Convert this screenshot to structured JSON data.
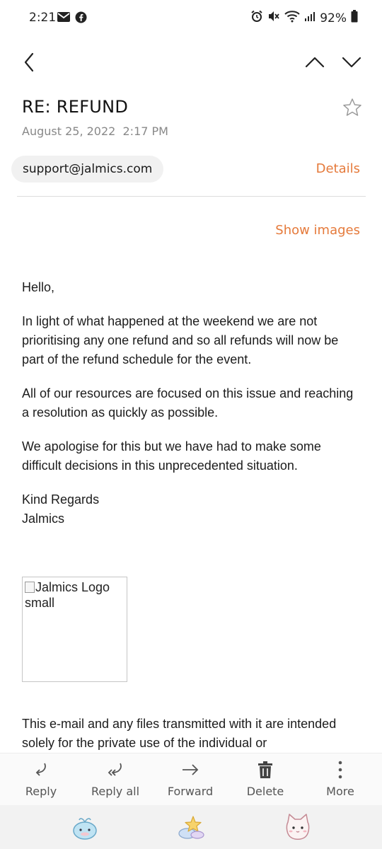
{
  "status_bar": {
    "time": "2:21",
    "battery": "92%",
    "icons": [
      "email-icon",
      "facebook-icon",
      "alarm-icon",
      "mute-icon",
      "wifi-icon",
      "signal-icon",
      "battery-icon"
    ]
  },
  "email": {
    "subject": "RE: REFUND",
    "date": "August 25, 2022  2:17 PM",
    "sender": "support@jalmics.com",
    "details_label": "Details",
    "show_images_label": "Show images",
    "body": {
      "greeting": "Hello,",
      "p1": "In light of what happened at the weekend we are not prioritising any one refund and so all refunds will now be part of the refund schedule for the event.",
      "p2": "All of our resources are focused on this issue and reaching a resolution as quickly as possible.",
      "p3": "We apologise for this but we have had to make some difficult decisions in this unprecedented situation.",
      "signoff": "Kind Regards",
      "signature": "Jalmics",
      "logo_alt": "Jalmics Logo small",
      "footer": "This e-mail and any files transmitted with it are intended solely for the private use of the individual or"
    }
  },
  "toolbar": {
    "reply": "Reply",
    "reply_all": "Reply all",
    "forward": "Forward",
    "delete": "Delete",
    "more": "More"
  },
  "colors": {
    "accent": "#e57a3b",
    "chip_bg": "#f1f1f1",
    "muted": "#888888"
  }
}
